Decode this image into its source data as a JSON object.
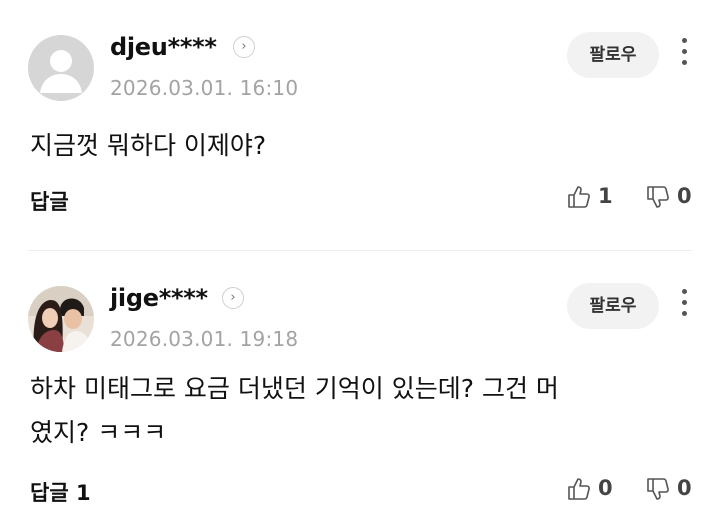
{
  "comments": [
    {
      "username": "djeu****",
      "timestamp": "2026.03.01. 16:10",
      "follow_label": "팔로우",
      "text": "지금껏 뭐하다 이제야?",
      "reply_label": "답글",
      "likes": "1",
      "dislikes": "0",
      "avatar": "default-person-avatar"
    },
    {
      "username": "jige****",
      "timestamp": "2026.03.01. 19:18",
      "follow_label": "팔로우",
      "text_line1": "하차 미태그로 요금 더냈던 기억이 있는데? 그건 머",
      "text_line2": "였지? ㅋㅋㅋ",
      "reply_label": "답글 1",
      "likes": "0",
      "dislikes": "0",
      "avatar": "couple-photo-avatar"
    }
  ],
  "icons": {
    "profile_arrow": "chevron-right-icon",
    "more": "kebab-menu-icon",
    "like": "thumbs-up-icon",
    "dislike": "thumbs-down-icon"
  },
  "colors": {
    "timestamp": "#a3a3a3",
    "follow_bg": "#f2f2f2",
    "divider": "#ededed"
  }
}
